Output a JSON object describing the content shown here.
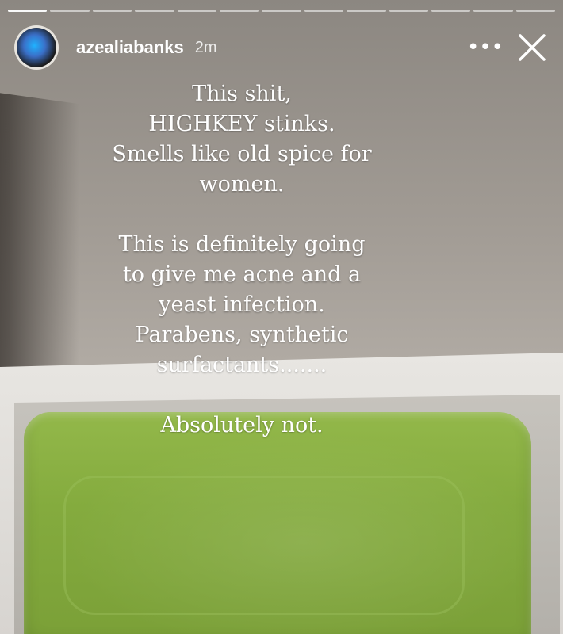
{
  "story": {
    "username": "azealiabanks",
    "time_ago": "2m",
    "progress": {
      "total": 13,
      "current": 1
    },
    "icons": {
      "more": "more-options-icon",
      "close": "close-icon"
    }
  },
  "caption": {
    "para1": [
      "This shit,",
      "HIGHKEY stinks.",
      "Smells like old spice for",
      "women."
    ],
    "para2": [
      "This is definitely going",
      "to give me acne and a",
      "yeast infection.",
      "Parabens, synthetic",
      "surfactants......."
    ],
    "para3": [
      "Absolutely not."
    ]
  },
  "colors": {
    "soap": "#88ad3f",
    "text": "#ffffff"
  }
}
